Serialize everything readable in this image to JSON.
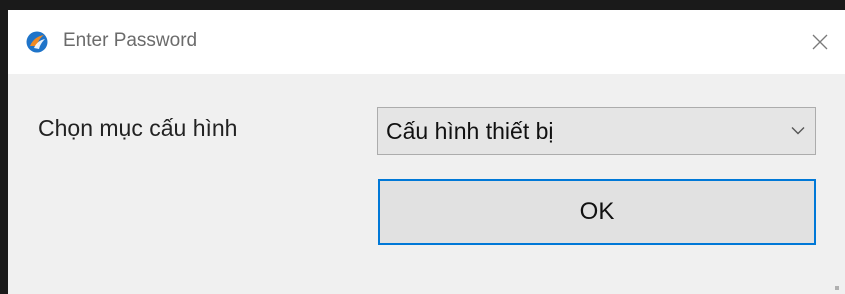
{
  "window": {
    "title": "Enter Password",
    "icon": "app-logo-icon",
    "close_icon": "close-icon"
  },
  "form": {
    "label": "Chọn mục cấu hình",
    "select": {
      "value": "Cấu hình thiết bị",
      "icon": "chevron-down-icon"
    },
    "ok_label": "OK"
  },
  "colors": {
    "accent": "#0078d7",
    "titlebar_bg": "#ffffff",
    "client_bg": "#f0f0f0",
    "border_dark": "#1a1a1a"
  }
}
